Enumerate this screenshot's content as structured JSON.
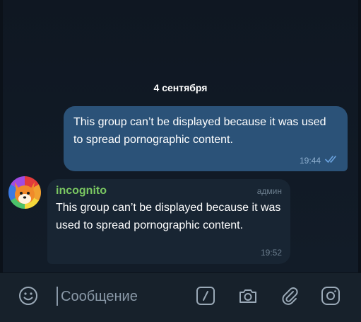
{
  "chat": {
    "date_separator": "4 сентября",
    "outgoing": {
      "text": "This group can’t be displayed because it was used to spread pornographic content.",
      "time": "19:44",
      "status_icon": "double-check-icon"
    },
    "incoming": {
      "sender": "incognito",
      "role": "админ",
      "text": "This group can’t be displayed because it was used to spread pornographic content.",
      "time": "19:52",
      "avatar_icon": "fox-avatar-icon"
    }
  },
  "composer": {
    "placeholder": "Сообщение",
    "emoji_icon": "emoji-icon",
    "command_icon": "slash-command-icon",
    "camera_icon": "camera-icon",
    "attach_icon": "paperclip-icon",
    "instagram_icon": "instagram-icon"
  },
  "colors": {
    "background": "#0e1621",
    "outgoing_bubble": "#2b5278",
    "incoming_bubble": "#182533",
    "sender_name": "#7bc862",
    "icon": "#9aa9b7"
  }
}
